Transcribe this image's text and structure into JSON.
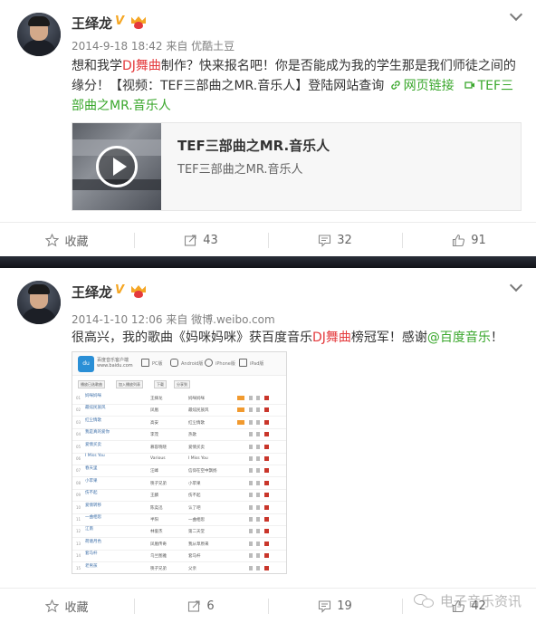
{
  "posts": [
    {
      "username": "王绎龙",
      "meta": "2014-9-18 18:42 来自 优酷土豆",
      "text_parts": [
        "想和我学",
        "DJ舞曲",
        "制作？快来报名吧！你是否能成为我的学生那是我们师徒之间的缘分！【视频：TEF三部曲之MR.音乐人】登陆网站查询 ",
        "网页链接",
        "TEF三部曲之MR.音乐人"
      ],
      "preview": {
        "title": "TEF三部曲之MR.音乐人",
        "subtitle": "TEF三部曲之MR.音乐人"
      },
      "actions": {
        "favorite": "收藏",
        "repost": "43",
        "comment": "32",
        "like": "91"
      }
    },
    {
      "username": "王绎龙",
      "meta": "2014-1-10 12:06 来自 微博.weibo.com",
      "text_parts": [
        "很高兴，我的歌曲《妈咪妈咪》获百度音乐",
        "DJ舞曲",
        "榜冠军！感谢",
        "@百度音乐",
        "！"
      ],
      "actions": {
        "favorite": "收藏",
        "repost": "6",
        "comment": "19",
        "like": "42"
      }
    }
  ],
  "screenshot": {
    "brand": "百度音乐客户端",
    "brand_sub": "www.baidu.com",
    "devices": [
      "PC版",
      "Android版",
      "iPhone版",
      "iPad版"
    ],
    "tools": [
      "播放已选歌曲",
      "加入播放列表",
      "下载",
      "分享到"
    ],
    "rows": [
      {
        "n": "01",
        "title": "妈咪妈咪",
        "sub": "",
        "artist": "王绎龙",
        "album": "妈咪妈咪"
      },
      {
        "n": "02",
        "title": "最炫民族风",
        "sub": "",
        "artist": "凤凰",
        "album": "最炫民族风"
      },
      {
        "n": "03",
        "title": "红尘情歌",
        "sub": "",
        "artist": "高安",
        "album": "红尘情歌"
      },
      {
        "n": "04",
        "title": "我是真的爱你",
        "sub": "",
        "artist": "李茂",
        "album": "热歌"
      },
      {
        "n": "05",
        "title": "爱情买卖",
        "sub": "",
        "artist": "慕容晓晓",
        "album": "爱情买卖"
      },
      {
        "n": "06",
        "title": "I Miss You",
        "sub": "",
        "artist": "Various",
        "album": "I Miss You"
      },
      {
        "n": "07",
        "title": "春天里",
        "sub": "",
        "artist": "汪峰",
        "album": "信仰在空中飘扬"
      },
      {
        "n": "08",
        "title": "小苹果",
        "sub": "",
        "artist": "筷子兄弟",
        "album": "小苹果"
      },
      {
        "n": "09",
        "title": "伤不起",
        "sub": "",
        "artist": "王麟",
        "album": "伤不起"
      },
      {
        "n": "10",
        "title": "爱情转移",
        "sub": "",
        "artist": "陈奕迅",
        "album": "认了吧"
      },
      {
        "n": "11",
        "title": "一曲相思",
        "sub": "",
        "artist": "半阳",
        "album": "一曲相思"
      },
      {
        "n": "12",
        "title": "江南",
        "sub": "",
        "artist": "林俊杰",
        "album": "第二天堂"
      },
      {
        "n": "13",
        "title": "荷塘月色",
        "sub": "",
        "artist": "凤凰传奇",
        "album": "我从草原来"
      },
      {
        "n": "14",
        "title": "套马杆",
        "sub": "",
        "artist": "乌兰图雅",
        "album": "套马杆"
      },
      {
        "n": "15",
        "title": "老男孩",
        "sub": "",
        "artist": "筷子兄弟",
        "album": "父亲"
      }
    ]
  },
  "watermark": "电子音乐资讯",
  "colors": {
    "accent_red": "#e4393c",
    "link_green": "#3aa72c",
    "vip_orange": "#f5a623"
  }
}
